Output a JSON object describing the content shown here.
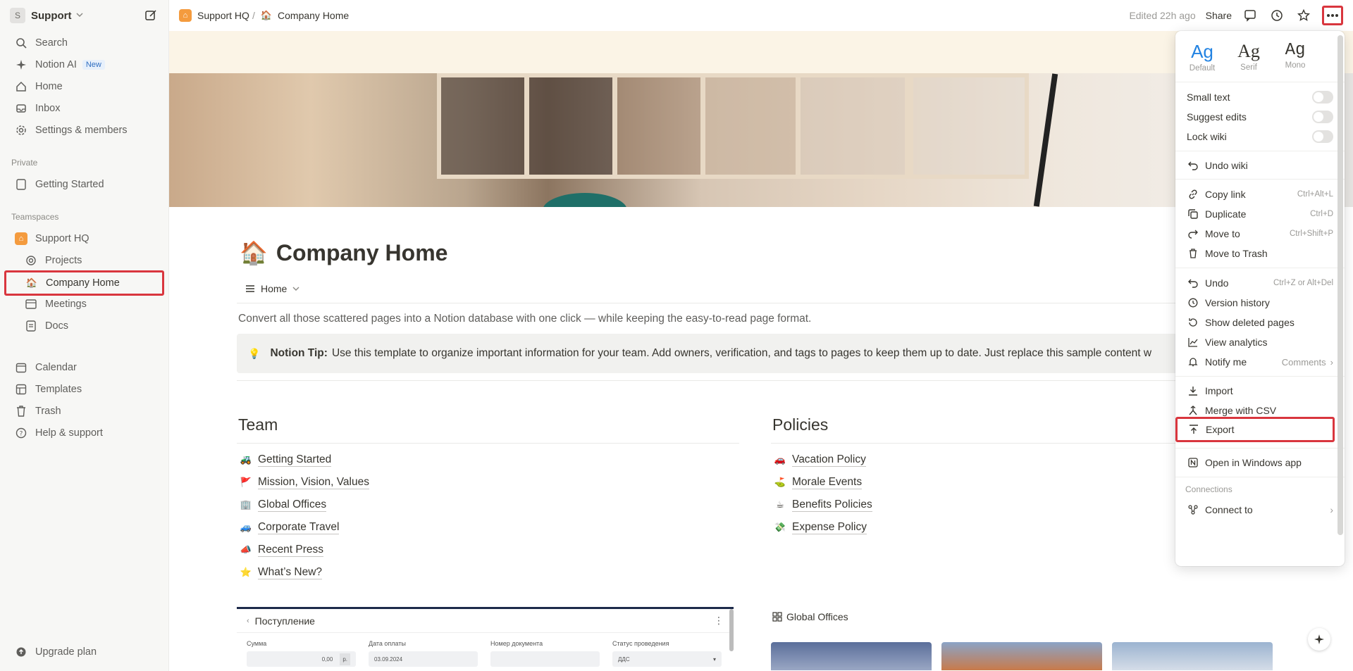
{
  "workspace": {
    "initial": "S",
    "name": "Support"
  },
  "sidebar": {
    "top": [
      {
        "label": "Search",
        "icon": "search-icon"
      },
      {
        "label": "Notion AI",
        "icon": "sparkle-icon",
        "badge": "New"
      },
      {
        "label": "Home",
        "icon": "home-icon"
      },
      {
        "label": "Inbox",
        "icon": "inbox-icon"
      },
      {
        "label": "Settings & members",
        "icon": "gear-icon"
      }
    ],
    "private_label": "Private",
    "private": [
      {
        "label": "Getting Started",
        "icon": "page-icon"
      }
    ],
    "teamspaces_label": "Teamspaces",
    "teamspace": {
      "label": "Support HQ"
    },
    "team_pages": [
      {
        "label": "Projects",
        "icon": "target-icon"
      },
      {
        "label": "Company Home",
        "icon": "house-emoji-icon"
      },
      {
        "label": "Meetings",
        "icon": "table-icon"
      },
      {
        "label": "Docs",
        "icon": "doc-icon"
      }
    ],
    "bottom": [
      {
        "label": "Calendar",
        "icon": "calendar-icon"
      },
      {
        "label": "Templates",
        "icon": "templates-icon"
      },
      {
        "label": "Trash",
        "icon": "trash-icon"
      },
      {
        "label": "Help & support",
        "icon": "help-icon"
      }
    ],
    "upgrade": "Upgrade plan"
  },
  "topbar": {
    "crumb1": "Support HQ",
    "sep": "/",
    "crumb2": "Company Home",
    "edited": "Edited 22h ago",
    "share": "Share"
  },
  "page": {
    "emoji": "🏠",
    "title": "Company Home",
    "view": "Home",
    "description": "Convert all those scattered pages into a Notion database with one click — while keeping the easy-to-read page format.",
    "tip_label": "Notion Tip:",
    "tip_text": "Use this template to organize important information for your team. Add owners, verification, and tags to pages to keep them up to date. Just replace this sample content w",
    "team_heading": "Team",
    "team_links": [
      {
        "emoji": "🚜",
        "label": "Getting Started"
      },
      {
        "emoji": "🚩",
        "label": "Mission, Vision, Values"
      },
      {
        "emoji": "🏢",
        "label": "Global Offices"
      },
      {
        "emoji": "🚙",
        "label": "Corporate Travel"
      },
      {
        "emoji": "📣",
        "label": "Recent Press"
      },
      {
        "emoji": "⭐",
        "label": "What’s New?"
      }
    ],
    "policies_heading": "Policies",
    "policy_links": [
      {
        "emoji": "🚗",
        "label": "Vacation Policy"
      },
      {
        "emoji": "⛳",
        "label": "Morale Events"
      },
      {
        "emoji": "☕",
        "label": "Benefits Policies"
      },
      {
        "emoji": "💸",
        "label": "Expense Policy"
      }
    ],
    "embed": {
      "title": "Поступление",
      "fields": [
        {
          "label": "Сумма",
          "value": "0,00"
        },
        {
          "label": "Дата оплаты",
          "value": "03.09.2024"
        },
        {
          "label": "Номер документа",
          "value": ""
        },
        {
          "label": "Статус проведения",
          "value": "ДДС"
        }
      ],
      "currency": "р."
    },
    "gallery_title": "Global Offices"
  },
  "menu": {
    "fonts": [
      {
        "ag": "Ag",
        "label": "Default"
      },
      {
        "ag": "Ag",
        "label": "Serif"
      },
      {
        "ag": "Ag",
        "label": "Mono"
      }
    ],
    "toggles": [
      "Small text",
      "Suggest edits",
      "Lock wiki"
    ],
    "undo_wiki": "Undo wiki",
    "group2": [
      {
        "label": "Copy link",
        "shortcut": "Ctrl+Alt+L"
      },
      {
        "label": "Duplicate",
        "shortcut": "Ctrl+D"
      },
      {
        "label": "Move to",
        "shortcut": "Ctrl+Shift+P"
      },
      {
        "label": "Move to Trash",
        "shortcut": ""
      }
    ],
    "group3": [
      {
        "label": "Undo",
        "shortcut": "Ctrl+Z or Alt+Del"
      },
      {
        "label": "Version history",
        "shortcut": ""
      },
      {
        "label": "Show deleted pages",
        "shortcut": ""
      },
      {
        "label": "View analytics",
        "shortcut": ""
      },
      {
        "label": "Notify me",
        "shortcut": "Comments"
      }
    ],
    "import": "Import",
    "merge_csv": "Merge with CSV",
    "export": "Export",
    "open_app": "Open in Windows app",
    "connections_label": "Connections",
    "connect_to": "Connect to"
  }
}
